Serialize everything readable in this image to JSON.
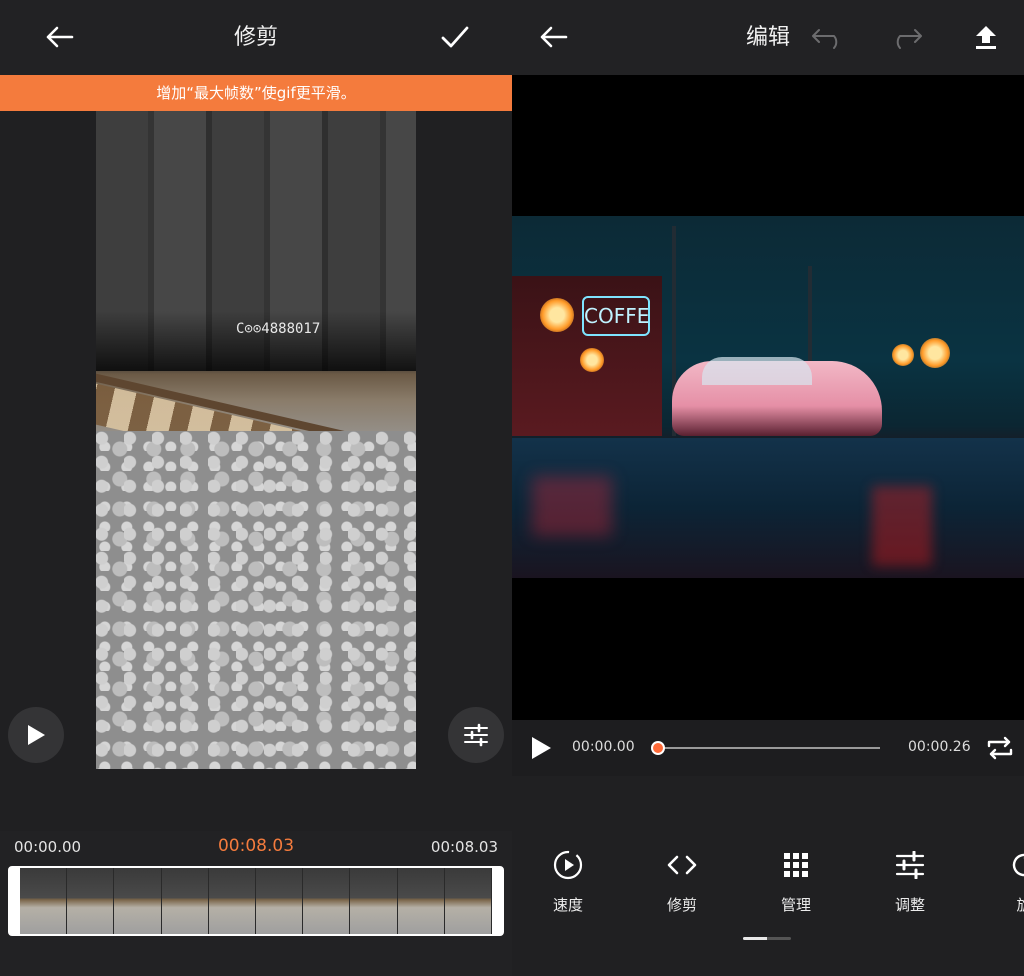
{
  "trim_screen": {
    "title": "修剪",
    "banner": "增加“最大帧数”使gif更平滑。",
    "video_overlay_text": "C⊙⊙4888017",
    "timeline": {
      "start": "00:00.00",
      "current": "00:08.03",
      "end": "00:08.03"
    },
    "filmstrip_frame_count": 10
  },
  "edit_screen": {
    "title": "编辑",
    "preview_sign_text": "COFFE",
    "playback": {
      "current_time": "00:00.00",
      "total_time": "00:00.26",
      "progress": 0
    },
    "tools": [
      {
        "id": "speed",
        "label": "速度",
        "icon": "speed-icon"
      },
      {
        "id": "trim",
        "label": "修剪",
        "icon": "code-brackets-icon"
      },
      {
        "id": "manage",
        "label": "管理",
        "icon": "grid-icon"
      },
      {
        "id": "adjust",
        "label": "调整",
        "icon": "sliders-icon"
      },
      {
        "id": "rotate",
        "label": "旋",
        "icon": "rotate-icon"
      }
    ]
  },
  "colors": {
    "accent": "#f47b3d",
    "progress_knob": "#ff6a38",
    "background": "#222224"
  }
}
